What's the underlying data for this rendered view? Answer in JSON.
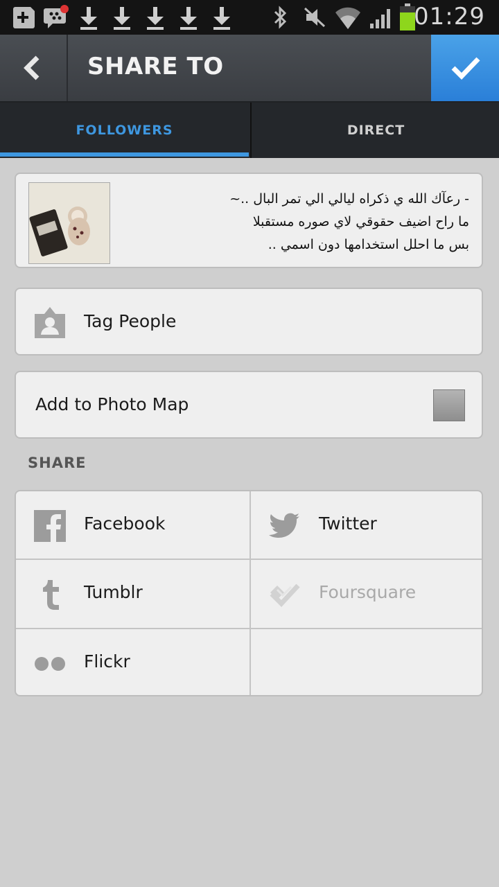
{
  "status_bar": {
    "time": "01:29",
    "icons": [
      "add-icon",
      "bbm-icon",
      "download-icon",
      "download-icon",
      "download-icon",
      "download-icon",
      "download-icon",
      "bluetooth-icon",
      "mute-icon",
      "wifi-icon",
      "signal-icon",
      "battery-icon"
    ]
  },
  "header": {
    "title": "SHARE TO",
    "back_icon": "chevron-left-icon",
    "confirm_icon": "checkmark-icon",
    "accent_color": "#3a8fe3"
  },
  "tabs": [
    {
      "label": "FOLLOWERS",
      "active": true
    },
    {
      "label": "DIRECT",
      "active": false
    }
  ],
  "caption": {
    "lines": [
      "- رعآك الله ي ذكراه ليالي الي تمر البال ..~",
      "ما راح اضيف حقوقي لاي صوره مستقبلا",
      "بس ما احلل استخدامها دون اسمي .."
    ]
  },
  "tag_people": {
    "label": "Tag People",
    "icon": "person-tag-icon"
  },
  "photo_map": {
    "label": "Add to Photo Map",
    "checked": false
  },
  "share": {
    "heading": "SHARE",
    "services": [
      {
        "label": "Facebook",
        "icon": "facebook-icon",
        "enabled": true
      },
      {
        "label": "Twitter",
        "icon": "twitter-icon",
        "enabled": true
      },
      {
        "label": "Tumblr",
        "icon": "tumblr-icon",
        "enabled": true
      },
      {
        "label": "Foursquare",
        "icon": "foursquare-icon",
        "enabled": false
      },
      {
        "label": "Flickr",
        "icon": "flickr-icon",
        "enabled": true
      }
    ]
  }
}
